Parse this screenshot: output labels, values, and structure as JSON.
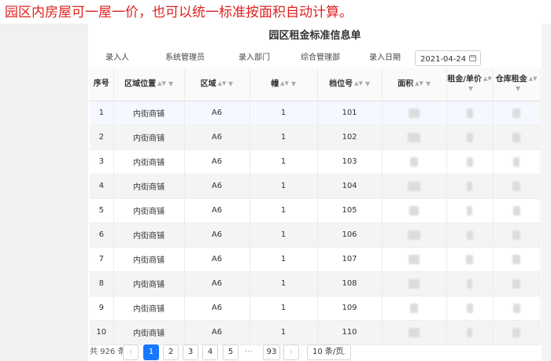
{
  "caption": "园区内房屋可一屋一价，也可以统一标准按面积自动计算。",
  "form": {
    "title": "园区租金标准信息单",
    "fields": [
      {
        "label": "录入人",
        "value": "系统管理员"
      },
      {
        "label": "录入部门",
        "value": "综合管理部"
      },
      {
        "label": "录入日期",
        "value": "2021-04-24"
      }
    ]
  },
  "table": {
    "headers": [
      "序号",
      "区域位置",
      "区域",
      "幢",
      "档位号",
      "面积",
      "租金/单价",
      "仓库租金"
    ],
    "rows": [
      [
        "1",
        "内街商铺",
        "A6",
        "1",
        "101"
      ],
      [
        "2",
        "内街商铺",
        "A6",
        "1",
        "102"
      ],
      [
        "3",
        "内街商铺",
        "A6",
        "1",
        "103"
      ],
      [
        "4",
        "内街商铺",
        "A6",
        "1",
        "104"
      ],
      [
        "5",
        "内街商铺",
        "A6",
        "1",
        "105"
      ],
      [
        "6",
        "内街商铺",
        "A6",
        "1",
        "106"
      ],
      [
        "7",
        "内街商铺",
        "A6",
        "1",
        "107"
      ],
      [
        "8",
        "内街商铺",
        "A6",
        "1",
        "108"
      ],
      [
        "9",
        "内街商铺",
        "A6",
        "1",
        "109"
      ],
      [
        "10",
        "内街商铺",
        "A6",
        "1",
        "110"
      ]
    ]
  },
  "pager": {
    "total": "共 926 条",
    "pages": [
      "1",
      "2",
      "3",
      "4",
      "5"
    ],
    "ellipsis": "···",
    "last_page": "93",
    "page_size": "10 条/页",
    "current": "1"
  },
  "icons": {
    "sort": "sort-icon",
    "filter": "filter-icon",
    "calendar": "calendar-icon"
  },
  "colors": {
    "caption": "#e02020",
    "accent": "#1677ff"
  }
}
